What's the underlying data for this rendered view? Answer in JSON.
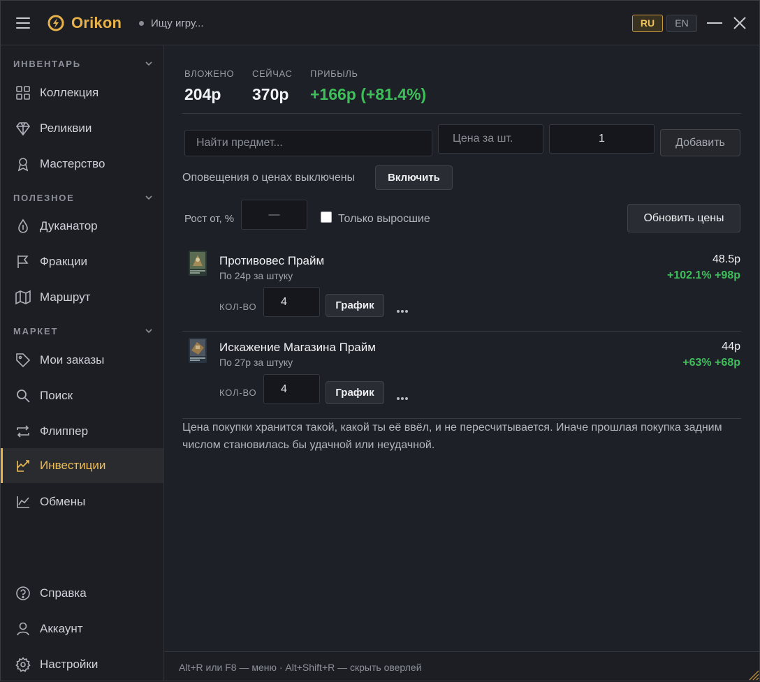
{
  "app": {
    "brand": "Orikon",
    "search_status": "Ищу игру...",
    "lang_ru": "RU",
    "lang_en": "EN",
    "accent_color": "#e8b24a"
  },
  "sidebar": {
    "sections": [
      {
        "title": "ИНВЕНТАРЬ",
        "items": [
          {
            "label": "Коллекция",
            "icon": "grid-icon"
          },
          {
            "label": "Реликвии",
            "icon": "diamond-icon"
          },
          {
            "label": "Мастерство",
            "icon": "medal-icon"
          }
        ]
      },
      {
        "title": "ПОЛЕЗНОЕ",
        "items": [
          {
            "label": "Дуканатор",
            "icon": "droplet-icon"
          },
          {
            "label": "Фракции",
            "icon": "flag-icon"
          },
          {
            "label": "Маршрут",
            "icon": "map-icon"
          }
        ]
      },
      {
        "title": "МАРКЕТ",
        "items": [
          {
            "label": "Мои заказы",
            "icon": "tag-icon"
          },
          {
            "label": "Поиск",
            "icon": "search-icon"
          },
          {
            "label": "Флиппер",
            "icon": "swap-icon"
          },
          {
            "label": "Инвестиции",
            "icon": "investments-icon",
            "active": true
          },
          {
            "label": "Обмены",
            "icon": "chart-icon"
          }
        ]
      }
    ],
    "bottom": [
      {
        "label": "Справка",
        "icon": "help-icon"
      },
      {
        "label": "Аккаунт",
        "icon": "user-icon"
      },
      {
        "label": "Настройки",
        "icon": "gear-icon"
      }
    ]
  },
  "summary": {
    "invested_label": "ВЛОЖЕНО",
    "invested_value": "204р",
    "now_label": "СЕЙЧАС",
    "now_value": "370р",
    "profit_label": "ПРИБЫЛЬ",
    "profit_value": "+166р (+81.4%)"
  },
  "add_form": {
    "item_placeholder": "Найти предмет...",
    "price_placeholder": "Цена за шт.",
    "quantity_value": "1",
    "add_button": "Добавить"
  },
  "alerts": {
    "text": "Оповещения о ценах выключены",
    "enable_button": "Включить"
  },
  "filters": {
    "growth_label": "Рост от, %",
    "growth_placeholder": "—",
    "only_grown_label": "Только выросшие",
    "only_grown_checked": false,
    "refresh_button": "Обновить цены"
  },
  "items": [
    {
      "name": "Противовес Прайм",
      "sub": "По 24р за штуку",
      "price": "48.5р",
      "gain": "+102.1% +98р",
      "qty_label": "КОЛ-ВО",
      "qty": "4",
      "chart_button": "График"
    },
    {
      "name": "Искажение Магазина Прайм",
      "sub": "По 27р за штуку",
      "price": "44р",
      "gain": "+63% +68р",
      "qty_label": "КОЛ-ВО",
      "qty": "4",
      "chart_button": "График"
    }
  ],
  "footnote": "Цена покупки хранится такой, какой ты её ввёл, и не пересчитывается. Иначе прошлая покупка задним числом становилась бы удачной или неудачной.",
  "statusbar": {
    "hint": "Alt+R или F8 — меню · Alt+Shift+R — скрыть оверлей"
  }
}
